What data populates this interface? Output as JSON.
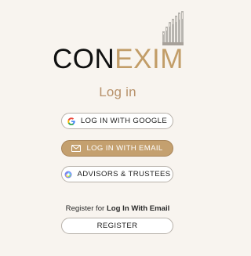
{
  "brand": {
    "logo_con": "CON",
    "logo_exim": "EXIM"
  },
  "page": {
    "title": "Log in"
  },
  "buttons": {
    "google": "LOG IN WITH GOOGLE",
    "email": "LOG IN WITH EMAIL",
    "advisors": "ADVISORS & TRUSTEES",
    "register": "REGISTER"
  },
  "register": {
    "prefix": "Register for ",
    "link": "Log In With Email"
  },
  "colors": {
    "background": "#f8f4ef",
    "accent": "#c4a06f",
    "accent_text": "#b7916a",
    "logo_dark": "#101010",
    "logo_gold": "#c29d68"
  },
  "icons": {
    "brand_mark": "stacked-bars-mark",
    "google": "google-icon",
    "email": "mail-icon",
    "advisors": "advisors-icon"
  }
}
